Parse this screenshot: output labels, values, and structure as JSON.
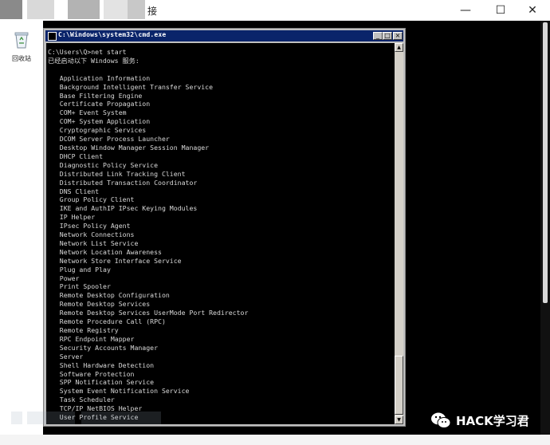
{
  "outer_window": {
    "title": "接",
    "controls": {
      "minimize": "—",
      "maximize": "☐",
      "close": "✕"
    }
  },
  "desktop": {
    "recycle_bin_label": "回收站"
  },
  "cmd": {
    "title": "C:\\Windows\\system32\\cmd.exe",
    "controls": {
      "minimize": "_",
      "maximize": "□",
      "close": "×"
    },
    "lines": [
      "C:\\Users\\Q>net start",
      "已经启动以下 Windows 服务:",
      "",
      "   Application Information",
      "   Background Intelligent Transfer Service",
      "   Base Filtering Engine",
      "   Certificate Propagation",
      "   COM+ Event System",
      "   COM+ System Application",
      "   Cryptographic Services",
      "   DCOM Server Process Launcher",
      "   Desktop Window Manager Session Manager",
      "   DHCP Client",
      "   Diagnostic Policy Service",
      "   Distributed Link Tracking Client",
      "   Distributed Transaction Coordinator",
      "   DNS Client",
      "   Group Policy Client",
      "   IKE and AuthIP IPsec Keying Modules",
      "   IP Helper",
      "   IPsec Policy Agent",
      "   Network Connections",
      "   Network List Service",
      "   Network Location Awareness",
      "   Network Store Interface Service",
      "   Plug and Play",
      "   Power",
      "   Print Spooler",
      "   Remote Desktop Configuration",
      "   Remote Desktop Services",
      "   Remote Desktop Services UserMode Port Redirector",
      "   Remote Procedure Call (RPC)",
      "   Remote Registry",
      "   RPC Endpoint Mapper",
      "   Security Accounts Manager",
      "   Server",
      "   Shell Hardware Detection",
      "   Software Protection",
      "   SPP Notification Service",
      "   System Event Notification Service",
      "   Task Scheduler",
      "   TCP/IP NetBIOS Helper",
      "   User Profile Service"
    ]
  },
  "watermark": {
    "text": "HACK学习君"
  },
  "colors": {
    "console_bg": "#000000",
    "console_text": "#d8d8d8",
    "cmd_titlebar": "#0a246a",
    "window_chrome": "#c0c0c0"
  }
}
